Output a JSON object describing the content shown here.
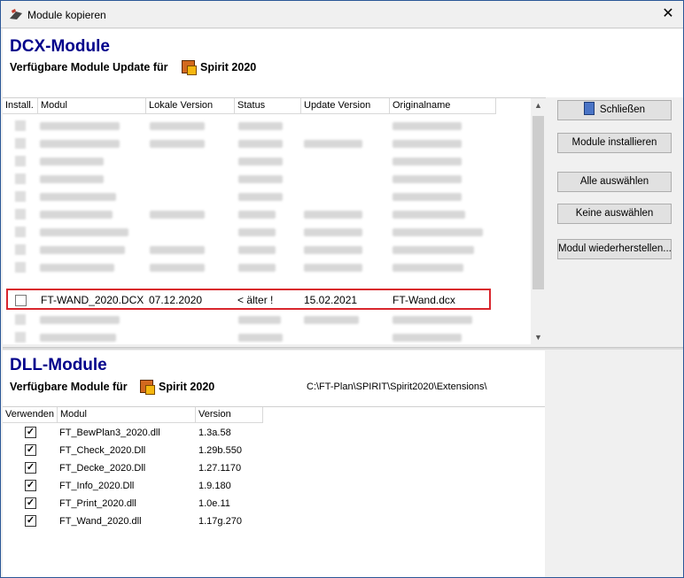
{
  "window": {
    "title": "Module kopieren",
    "close_label": "✕"
  },
  "dcx": {
    "heading": "DCX-Module",
    "subheading": "Verfügbare Module Update für",
    "product": "Spirit 2020",
    "columns": [
      "Install.",
      "Modul",
      "Lokale Version",
      "Status",
      "Update Version",
      "Originalname"
    ],
    "highlighted_row": {
      "checked": false,
      "modul": "FT-WAND_2020.DCX",
      "lokale_version": "07.12.2020",
      "status": "< älter !",
      "update_version": "15.02.2021",
      "originalname": "FT-Wand.dcx"
    }
  },
  "buttons": {
    "close": "Schließen",
    "install": "Module installieren",
    "select_all": "Alle auswählen",
    "select_none": "Keine auswählen",
    "restore": "Modul wiederherstellen..."
  },
  "dll": {
    "heading": "DLL-Module",
    "subheading": "Verfügbare Module für",
    "product": "Spirit 2020",
    "path": "C:\\FT-Plan\\SPIRIT\\Spirit2020\\Extensions\\",
    "columns": [
      "Verwenden",
      "Modul",
      "Version"
    ],
    "rows": [
      {
        "checked": true,
        "modul": "FT_BewPlan3_2020.dll",
        "version": "1.3a.58"
      },
      {
        "checked": true,
        "modul": "FT_Check_2020.Dll",
        "version": "1.29b.550"
      },
      {
        "checked": true,
        "modul": "FT_Decke_2020.Dll",
        "version": "1.27.1170"
      },
      {
        "checked": true,
        "modul": "FT_Info_2020.Dll",
        "version": "1.9.180"
      },
      {
        "checked": true,
        "modul": "FT_Print_2020.dll",
        "version": "1.0e.11"
      },
      {
        "checked": true,
        "modul": "FT_Wand_2020.dll",
        "version": "1.17g.270"
      }
    ]
  }
}
